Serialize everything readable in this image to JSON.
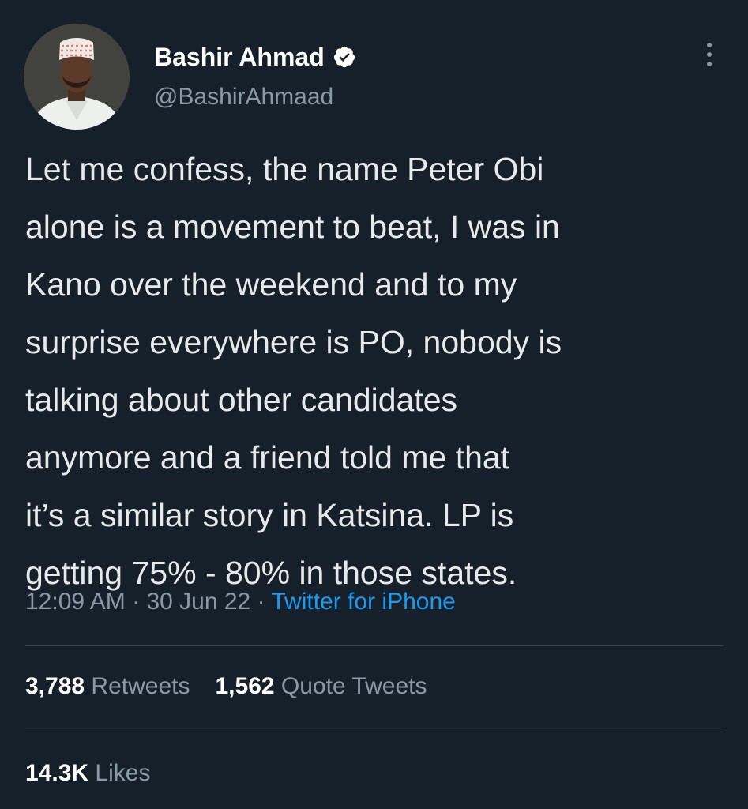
{
  "author": {
    "display_name": "Bashir Ahmad",
    "handle": "@BashirAhmaad",
    "verified": true,
    "verified_badge_color": "#ffffff"
  },
  "tweet": {
    "lines": [
      "Let me confess, the name Peter Obi",
      "alone is a movement to beat, I was in",
      "Kano over the weekend and to my",
      "surprise everywhere is PO, nobody is",
      "talking about other candidates",
      "anymore and a friend told me that",
      "it’s a similar story in Katsina. LP is",
      "getting 75% - 80% in those states."
    ]
  },
  "meta": {
    "time": "12:09 AM",
    "separator": "·",
    "date": "30 Jun 22",
    "source": "Twitter for iPhone"
  },
  "stats": {
    "retweets_count": "3,788",
    "retweets_label": "Retweets",
    "quote_tweets_count": "1,562",
    "quote_tweets_label": "Quote Tweets",
    "likes_count": "14.3K",
    "likes_label": "Likes"
  },
  "icons": {
    "verified": "verified-badge-icon",
    "more": "more-options-icon"
  },
  "colors": {
    "background": "#15202b",
    "text_primary": "#e7e9ea",
    "text_secondary": "#8b98a5",
    "link": "#1d9bf0",
    "divider": "#38444d"
  }
}
